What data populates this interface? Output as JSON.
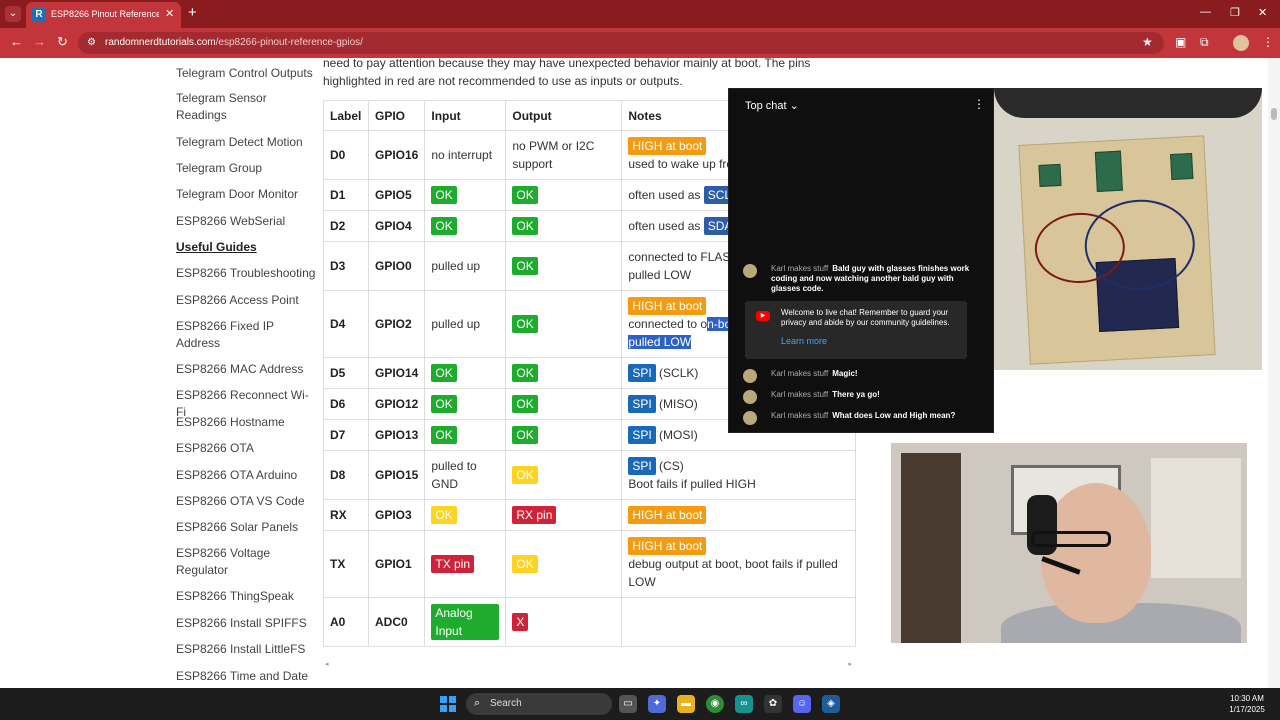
{
  "browser": {
    "tab_title": "ESP8266 Pinout Reference: Wh",
    "tab_favicon": "R",
    "url_host": "randomnerdtutorials.com",
    "url_path": "/esp8266-pinout-reference-gpios/"
  },
  "sidebar": {
    "items": [
      "Telegram Control Outputs",
      "Telegram Sensor Readings",
      "Telegram Detect Motion",
      "Telegram Group",
      "Telegram Door Monitor",
      "ESP8266 WebSerial",
      "Useful Guides",
      "ESP8266 Troubleshooting",
      "ESP8266 Access Point",
      "ESP8266 Fixed IP Address",
      "ESP8266 MAC Address",
      "ESP8266 Reconnect Wi-Fi",
      "ESP8266 Hostname",
      "ESP8266 OTA",
      "ESP8266 OTA Arduino",
      "ESP8266 OTA VS Code",
      "ESP8266 Solar Panels",
      "ESP8266 Voltage Regulator",
      "ESP8266 ThingSpeak",
      "ESP8266 Install SPIFFS",
      "ESP8266 Install LittleFS",
      "ESP8266 Time and Date"
    ]
  },
  "content": {
    "intro_top": "need to pay attention because they may have unexpected behavior mainly at boot. The pins",
    "intro_bottom": "highlighted in red are not recommended to use as inputs or outputs."
  },
  "table": {
    "headers": [
      "Label",
      "GPIO",
      "Input",
      "Output",
      "Notes"
    ],
    "rows": [
      {
        "label": "D0",
        "gpio": "GPIO16",
        "input": "no interrupt",
        "output": "no PWM or I2C support",
        "note_badge": "HIGH at boot",
        "note_text": "used to wake up fro"
      },
      {
        "label": "D1",
        "gpio": "GPIO5",
        "input": "OK",
        "output": "OK",
        "note_text": "often used as",
        "note_badge": "SCL"
      },
      {
        "label": "D2",
        "gpio": "GPIO4",
        "input": "OK",
        "output": "OK",
        "note_text": "often used as",
        "note_badge": "SDA"
      },
      {
        "label": "D3",
        "gpio": "GPIO0",
        "input": "pulled up",
        "output": "OK",
        "note_line1": "connected to FLAS",
        "note_line2": "pulled LOW"
      },
      {
        "label": "D4",
        "gpio": "GPIO2",
        "input": "pulled up",
        "output": "OK",
        "note_badge": "HIGH at boot",
        "note_text": "connected to o",
        "note_sel1": "n-bo",
        "note_sel2": "pulled LOW"
      },
      {
        "label": "D5",
        "gpio": "GPIO14",
        "input": "OK",
        "output": "OK",
        "note_badge": "SPI",
        "note_text": "(SCLK)"
      },
      {
        "label": "D6",
        "gpio": "GPIO12",
        "input": "OK",
        "output": "OK",
        "note_badge": "SPI",
        "note_text": "(MISO)"
      },
      {
        "label": "D7",
        "gpio": "GPIO13",
        "input": "OK",
        "output": "OK",
        "note_badge": "SPI",
        "note_text": "(MOSI)"
      },
      {
        "label": "D8",
        "gpio": "GPIO15",
        "input": "pulled to GND",
        "output": "OK",
        "note_badge": "SPI",
        "note_text": "(CS)",
        "note_line2": "Boot fails if pulled HIGH"
      },
      {
        "label": "RX",
        "gpio": "GPIO3",
        "input": "OK",
        "output": "RX pin",
        "note_badge": "HIGH at boot"
      },
      {
        "label": "TX",
        "gpio": "GPIO1",
        "input": "TX pin",
        "output": "OK",
        "note_badge": "HIGH at boot",
        "note_text": "debug output at boot, boot fails if pulled LOW"
      },
      {
        "label": "A0",
        "gpio": "ADC0",
        "input": "Analog Input",
        "output": "X",
        "note_text": ""
      }
    ]
  },
  "chat": {
    "title": "Top chat",
    "messages": [
      {
        "author": "Karl makes stuff",
        "text": "Bald guy with glasses finishes work coding and now watching another bald guy with glasses code."
      },
      {
        "author": "Karl makes stuff",
        "text": "Magic!"
      },
      {
        "author": "Karl makes stuff",
        "text": "There ya go!"
      },
      {
        "author": "Karl makes stuff",
        "text": "What does Low and High mean?"
      }
    ],
    "notice": "Welcome to live chat! Remember to guard your privacy and abide by our community guidelines.",
    "notice_link": "Learn more"
  },
  "taskbar": {
    "search_placeholder": "Search",
    "time": "10:30 AM",
    "date": "1/17/2025"
  },
  "colors": {
    "ok": "#1fab2d",
    "warn": "#ffd321",
    "boot": "#f39c12",
    "bad": "#d0223a",
    "spi": "#1a68b8"
  }
}
